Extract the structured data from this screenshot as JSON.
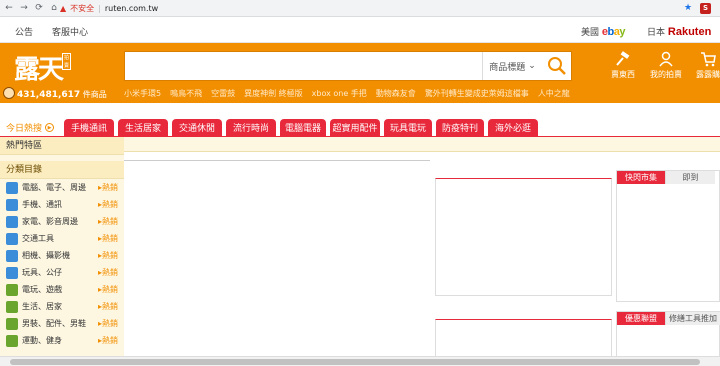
{
  "browser": {
    "insecure_label": "不安全",
    "url": "ruten.com.tw",
    "extension_label": "S"
  },
  "topbar": {
    "announce": "公告",
    "service": "客服中心",
    "usa": "美國",
    "ebay": [
      "e",
      "b",
      "a",
      "y"
    ],
    "japan": "日本",
    "rakuten": "Rakuten"
  },
  "header": {
    "logo": "露天",
    "logo_badge": "拍賣",
    "product_count": "431,481,617",
    "product_unit": "件商品",
    "search_placeholder": "",
    "search_category": "商品標題",
    "hotwords": [
      "小米手環5",
      "鳴鳥不飛",
      "空雷鼓",
      "異度神劍 終極版",
      "xbox one 手把",
      "動物森友會",
      "驚外刊轉生變成史萊姆這檔事",
      "人中之龍"
    ],
    "sell_label": "賣東西",
    "my_auction_label": "我的拍賣",
    "cart_label": "露露購"
  },
  "tabs": {
    "today": "今日熱搜",
    "items": [
      "手機通訊",
      "生活居家",
      "交通休閒",
      "流行時尚",
      "電腦電器",
      "超實用配件",
      "玩具電玩",
      "防疫特刊",
      "海外必逛"
    ]
  },
  "sidebar": {
    "hot_zone": "熱門特區",
    "category": "分類目錄",
    "items": [
      {
        "label": "電腦、電子、周邊",
        "hot": "熱銷",
        "color": "#3c8dd9"
      },
      {
        "label": "手機、通訊",
        "hot": "熱銷",
        "color": "#3c8dd9"
      },
      {
        "label": "家電、影音周邊",
        "hot": "熱銷",
        "color": "#3c8dd9"
      },
      {
        "label": "交通工具",
        "hot": "熱銷",
        "color": "#3c8dd9"
      },
      {
        "label": "相機、攝影機",
        "hot": "熱銷",
        "color": "#3c8dd9"
      },
      {
        "label": "玩具、公仔",
        "hot": "熱銷",
        "color": "#3c8dd9"
      },
      {
        "label": "電玩、遊戲",
        "hot": "熱銷",
        "color": "#6aa52e"
      },
      {
        "label": "生活、居家",
        "hot": "熱銷",
        "color": "#6aa52e"
      },
      {
        "label": "男裝、配件、男鞋",
        "hot": "熱銷",
        "color": "#6aa52e"
      },
      {
        "label": "運動、健身",
        "hot": "熱銷",
        "color": "#6aa52e"
      }
    ]
  },
  "panels": {
    "news_tab": "快閃市集",
    "news_tab2": "即到",
    "activity_tab": "優惠聯盟",
    "activity_tab2": "修繕工具推加"
  }
}
